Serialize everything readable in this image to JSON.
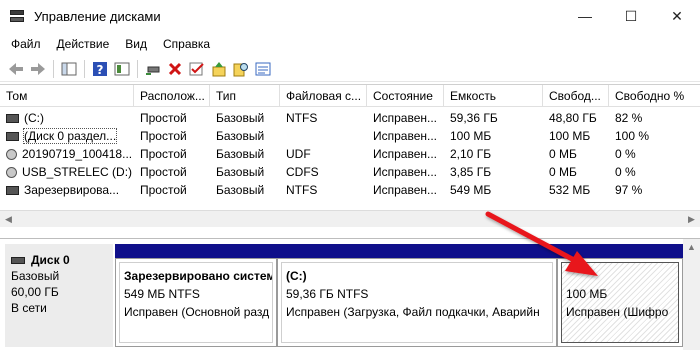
{
  "window": {
    "title": "Управление дисками",
    "minimize_glyph": "—",
    "maximize_glyph": "☐",
    "close_glyph": "✕"
  },
  "menu": [
    "Файл",
    "Действие",
    "Вид",
    "Справка"
  ],
  "toolbar": {
    "icons": [
      "back-arrow-icon",
      "forward-arrow-icon",
      "console-tree-icon",
      "help-icon",
      "help-topics-icon",
      "connect-drive-icon",
      "delete-icon",
      "check-icon",
      "upload-icon",
      "search-properties-icon",
      "properties-icon"
    ]
  },
  "table": {
    "columns": [
      "Том",
      "Располож...",
      "Тип",
      "Файловая с...",
      "Состояние",
      "Емкость",
      "Свобод...",
      "Свободно %"
    ],
    "rows": [
      {
        "icon": "drive-icon",
        "volume": "(C:)",
        "layout": "Простой",
        "type": "Базовый",
        "fs": "NTFS",
        "status": "Исправен...",
        "capacity": "59,36 ГБ",
        "free": "48,80 ГБ",
        "free_pct": "82 %"
      },
      {
        "icon": "drive-icon",
        "volume": "(Диск 0 раздел...",
        "layout": "Простой",
        "type": "Базовый",
        "fs": "",
        "status": "Исправен...",
        "capacity": "100 МБ",
        "free": "100 МБ",
        "free_pct": "100 %"
      },
      {
        "icon": "cd-icon",
        "volume": "20190719_100418...",
        "layout": "Простой",
        "type": "Базовый",
        "fs": "UDF",
        "status": "Исправен...",
        "capacity": "2,10 ГБ",
        "free": "0 МБ",
        "free_pct": "0 %"
      },
      {
        "icon": "cd-icon",
        "volume": "USB_STRELEC (D:)",
        "layout": "Простой",
        "type": "Базовый",
        "fs": "CDFS",
        "status": "Исправен...",
        "capacity": "3,85 ГБ",
        "free": "0 МБ",
        "free_pct": "0 %"
      },
      {
        "icon": "drive-icon",
        "volume": "Зарезервирова...",
        "layout": "Простой",
        "type": "Базовый",
        "fs": "NTFS",
        "status": "Исправен...",
        "capacity": "549 МБ",
        "free": "532 МБ",
        "free_pct": "97 %"
      }
    ]
  },
  "disk": {
    "name": "Диск 0",
    "type": "Базовый",
    "size": "60,00 ГБ",
    "state": "В сети"
  },
  "partitions": [
    {
      "name": "Зарезервировано систем",
      "size_fs": "549 МБ NTFS",
      "status": "Исправен (Основной разд"
    },
    {
      "name": "(C:)",
      "size_fs": "59,36 ГБ NTFS",
      "status": "Исправен (Загрузка, Файл подкачки, Аварийн"
    },
    {
      "name": "",
      "size_fs": "100 МБ",
      "status": "Исправен (Шифро"
    }
  ],
  "colors": {
    "partition_bar": "#0f0f8a",
    "annotation_arrow": "#e8141a"
  }
}
